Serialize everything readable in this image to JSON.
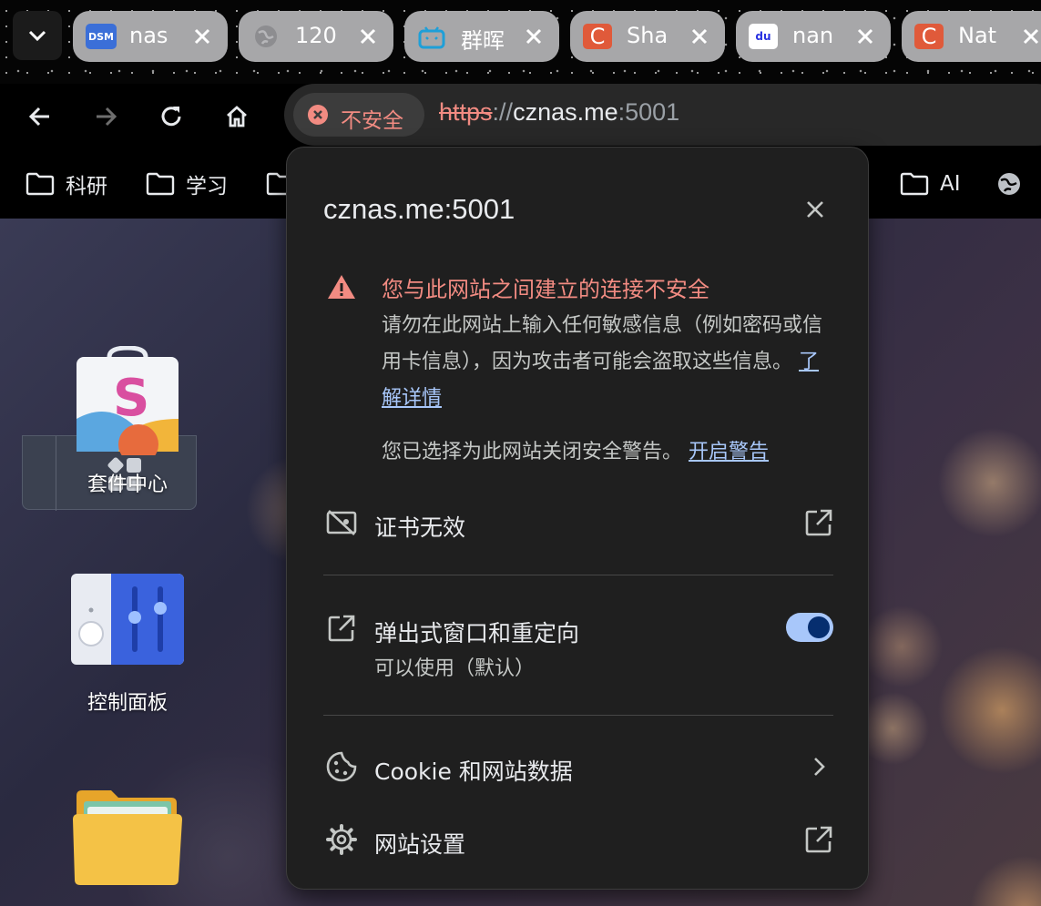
{
  "tabs": [
    {
      "title": "nas",
      "favicon": "dsm-icon",
      "favicon_text": "DSM",
      "favicon_color": "#3b6fd8"
    },
    {
      "title": "120",
      "favicon": "globe-icon",
      "favicon_color": "#8a8a8a"
    },
    {
      "title": "群晖",
      "favicon": "bilibili-icon",
      "favicon_color": "#1e9fd8"
    },
    {
      "title": "Sha",
      "favicon": "csdn-icon",
      "favicon_text": "C",
      "favicon_color": "#e05a3a"
    },
    {
      "title": "nan",
      "favicon": "baidu-icon",
      "favicon_text": "du",
      "favicon_color": "#2932e1"
    },
    {
      "title": "Nat",
      "favicon": "csdn-icon",
      "favicon_text": "C",
      "favicon_color": "#e05a3a"
    }
  ],
  "omnibox": {
    "security_label": "不安全",
    "url_scheme": "https",
    "url_sep": "://",
    "url_host": "cznas.me",
    "url_port": ":5001"
  },
  "bookmarks": [
    {
      "label": "科研"
    },
    {
      "label": "学习"
    },
    {
      "label": "AI"
    }
  ],
  "popup": {
    "site": "cznas.me:5001",
    "warning_title": "您与此网站之间建立的连接不安全",
    "warning_body": "请勿在此网站上输入任何敏感信息（例如密码或信用卡信息），因为攻击者可能会盗取这些信息。",
    "learn_more": "了解详情",
    "warnings_off_text": "您已选择为此网站关闭安全警告。",
    "reenable_link": "开启警告",
    "cert_label": "证书无效",
    "popups_label": "弹出式窗口和重定向",
    "popups_sub": "可以使用（默认）",
    "popups_enabled": true,
    "cookies_label": "Cookie 和网站数据",
    "site_settings_label": "网站设置"
  },
  "desktop": {
    "apps": [
      {
        "label": "套件中心",
        "icon": "package-center-icon"
      },
      {
        "label": "控制面板",
        "icon": "control-panel-icon"
      },
      {
        "label": "",
        "icon": "folder-icon"
      }
    ]
  },
  "colors": {
    "danger": "#f28b82",
    "link": "#a8c7fa",
    "popup_bg": "#1f1f1f",
    "toggle_on": "#a8c7fa"
  }
}
